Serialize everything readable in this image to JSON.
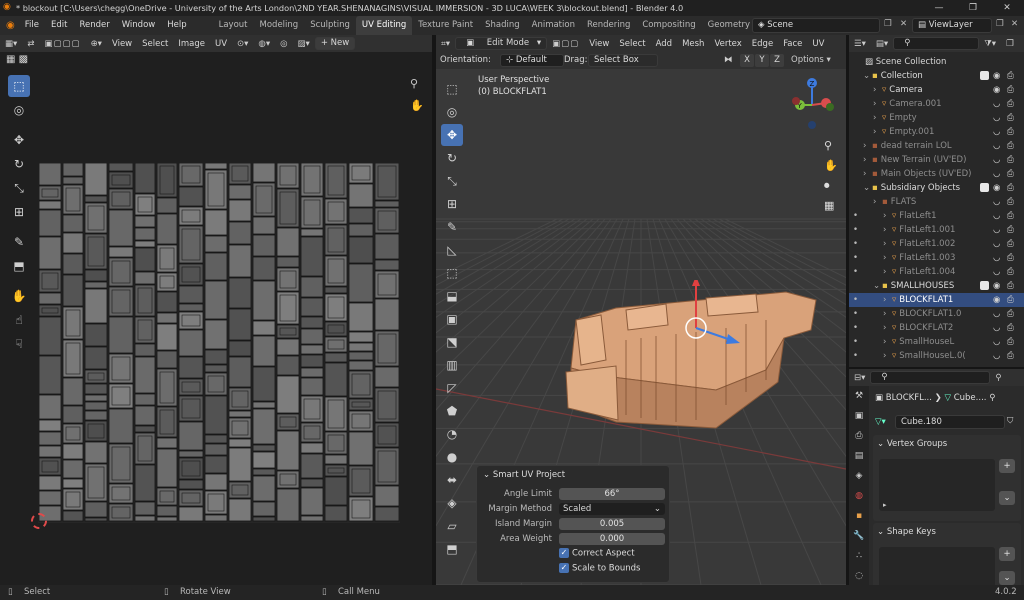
{
  "window": {
    "title": "* blockout [C:\\Users\\chegg\\OneDrive - University of the Arts London\\2ND YEAR.SHENANAGINS\\VISUAL IMMERSION - 3D LUCA\\WEEK 3\\blockout.blend] - Blender 4.0",
    "minimize": "—",
    "restore": "❐",
    "close": "✕"
  },
  "menu": [
    "File",
    "Edit",
    "Render",
    "Window",
    "Help"
  ],
  "workspaces": [
    "Layout",
    "Modeling",
    "Sculpting",
    "UV Editing",
    "Texture Paint",
    "Shading",
    "Animation",
    "Rendering",
    "Compositing",
    "Geometry Nodes",
    "Scriptin"
  ],
  "active_workspace": "UV Editing",
  "scene": "Scene",
  "view_layer": "ViewLayer",
  "uv_editor": {
    "menus": [
      "View",
      "Select",
      "Image",
      "UV"
    ],
    "new_label": "+ New"
  },
  "viewport": {
    "mode": "Edit Mode",
    "menus": [
      "View",
      "Select",
      "Add",
      "Mesh",
      "Vertex",
      "Edge",
      "Face",
      "UV"
    ],
    "orientation_label": "Orientation:",
    "orientation_value": "Default",
    "drag_label": "Drag:",
    "drag_value": "Select Box",
    "axes": [
      "X",
      "Y",
      "Z"
    ],
    "options_label": "Options",
    "perspective": "User Perspective",
    "object_info": "(0) BLOCKFLAT1"
  },
  "operator_panel": {
    "title": "Smart UV Project",
    "angle_limit_label": "Angle Limit",
    "angle_limit": "66°",
    "margin_method_label": "Margin Method",
    "margin_method": "Scaled",
    "island_margin_label": "Island Margin",
    "island_margin": "0.005",
    "area_weight_label": "Area Weight",
    "area_weight": "0.000",
    "correct_aspect": "Correct Aspect",
    "scale_to_bounds": "Scale to Bounds"
  },
  "outliner": {
    "root": "Scene Collection",
    "items": [
      {
        "label": "Collection",
        "depth": 1,
        "kind": "coll"
      },
      {
        "label": "Camera",
        "depth": 2,
        "kind": "obj"
      },
      {
        "label": "Camera.001",
        "depth": 2,
        "kind": "obj",
        "dim": true
      },
      {
        "label": "Empty",
        "depth": 2,
        "kind": "obj",
        "dim": true
      },
      {
        "label": "Empty.001",
        "depth": 2,
        "kind": "obj",
        "dim": true
      },
      {
        "label": "dead terrain LOL",
        "depth": 1,
        "kind": "coll",
        "dim": true
      },
      {
        "label": "New Terrain (UV'ED)",
        "depth": 1,
        "kind": "coll",
        "dim": true
      },
      {
        "label": "Main Objects (UV'ED)",
        "depth": 1,
        "kind": "coll",
        "dim": true
      },
      {
        "label": "Subsidiary Objects",
        "depth": 1,
        "kind": "coll"
      },
      {
        "label": "FLATS",
        "depth": 2,
        "kind": "coll",
        "dim": true
      },
      {
        "label": "FlatLeft1",
        "depth": 3,
        "kind": "obj",
        "dim": true
      },
      {
        "label": "FlatLeft1.001",
        "depth": 3,
        "kind": "obj",
        "dim": true
      },
      {
        "label": "FlatLeft1.002",
        "depth": 3,
        "kind": "obj",
        "dim": true
      },
      {
        "label": "FlatLeft1.003",
        "depth": 3,
        "kind": "obj",
        "dim": true
      },
      {
        "label": "FlatLeft1.004",
        "depth": 3,
        "kind": "obj",
        "dim": true
      },
      {
        "label": "SMALLHOUSES",
        "depth": 2,
        "kind": "coll"
      },
      {
        "label": "BLOCKFLAT1",
        "depth": 3,
        "kind": "obj",
        "active": true
      },
      {
        "label": "BLOCKFLAT1.0",
        "depth": 3,
        "kind": "obj",
        "dim": true
      },
      {
        "label": "BLOCKFLAT2",
        "depth": 3,
        "kind": "obj",
        "dim": true
      },
      {
        "label": "SmallHouseL",
        "depth": 3,
        "kind": "obj",
        "dim": true
      },
      {
        "label": "SmallHouseL.0(",
        "depth": 3,
        "kind": "obj",
        "dim": true
      }
    ]
  },
  "properties": {
    "breadcrumb_object": "BLOCKFL...",
    "breadcrumb_data": "Cube....",
    "mesh_name": "Cube.180",
    "vertex_groups": "Vertex Groups",
    "shape_keys": "Shape Keys"
  },
  "statusbar": {
    "select": "Select",
    "rotate": "Rotate View",
    "call_menu": "Call Menu",
    "version": "4.0.2"
  }
}
